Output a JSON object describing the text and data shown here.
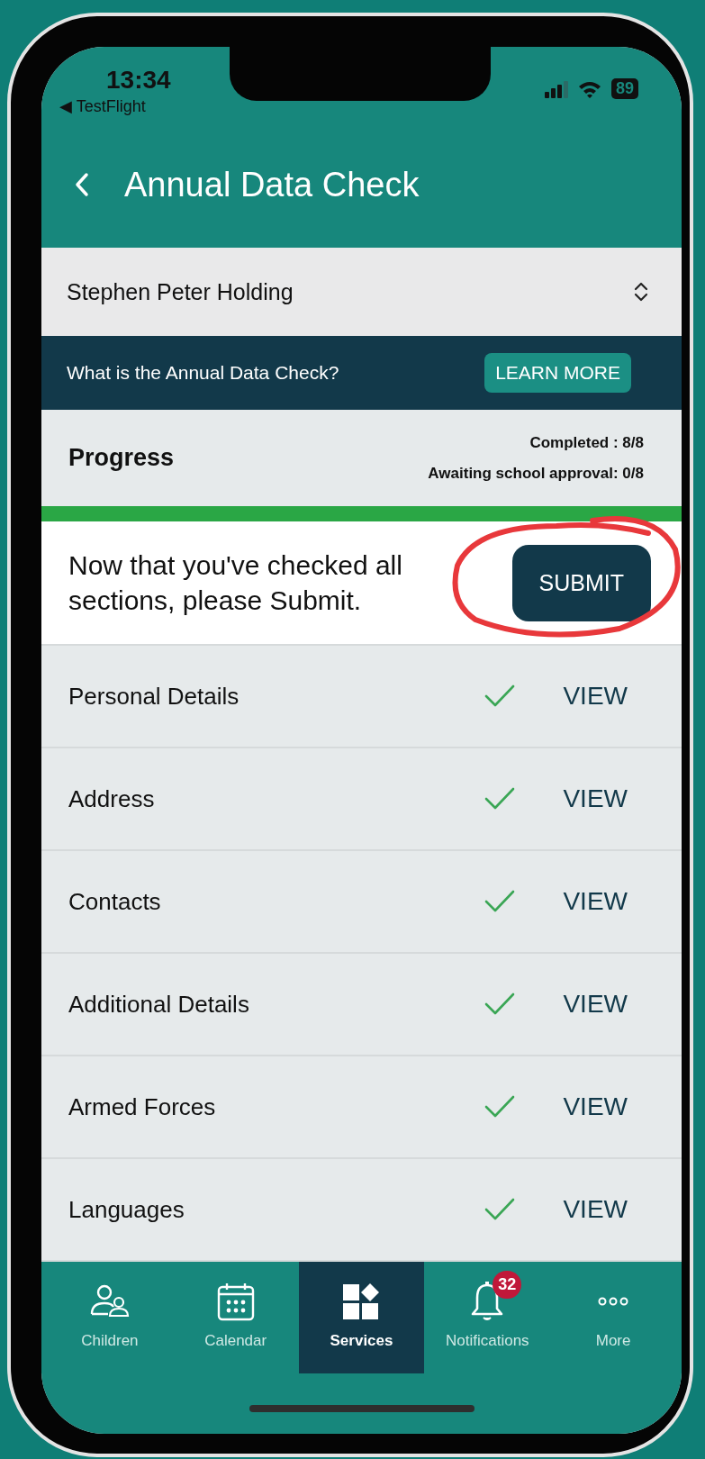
{
  "status_bar": {
    "time": "13:34",
    "back_app": "◀ TestFlight",
    "battery": "89"
  },
  "header": {
    "title": "Annual Data Check"
  },
  "student_selector": {
    "name": "Stephen Peter Holding"
  },
  "info_banner": {
    "text": "What is the Annual Data Check?",
    "button": "LEARN MORE"
  },
  "progress": {
    "title": "Progress",
    "completed": "Completed : 8/8",
    "awaiting": "Awaiting school approval: 0/8",
    "level": 1
  },
  "submit_prompt": {
    "text": "Now that you've checked all sections, please Submit.",
    "button": "SUBMIT"
  },
  "sections": [
    {
      "name": "Personal Details",
      "checked": true,
      "action": "VIEW"
    },
    {
      "name": "Address",
      "checked": true,
      "action": "VIEW"
    },
    {
      "name": "Contacts",
      "checked": true,
      "action": "VIEW"
    },
    {
      "name": "Additional Details",
      "checked": true,
      "action": "VIEW"
    },
    {
      "name": "Armed Forces",
      "checked": true,
      "action": "VIEW"
    },
    {
      "name": "Languages",
      "checked": true,
      "action": "VIEW"
    }
  ],
  "tab_bar": [
    {
      "label": "Children",
      "kind": "people",
      "selected": false
    },
    {
      "label": "Calendar",
      "kind": "calendar",
      "selected": false
    },
    {
      "label": "Services",
      "kind": "grid",
      "selected": true
    },
    {
      "label": "Notifications",
      "kind": "bell",
      "selected": false,
      "badge": "32"
    },
    {
      "label": "More",
      "kind": "dots",
      "selected": false
    }
  ]
}
